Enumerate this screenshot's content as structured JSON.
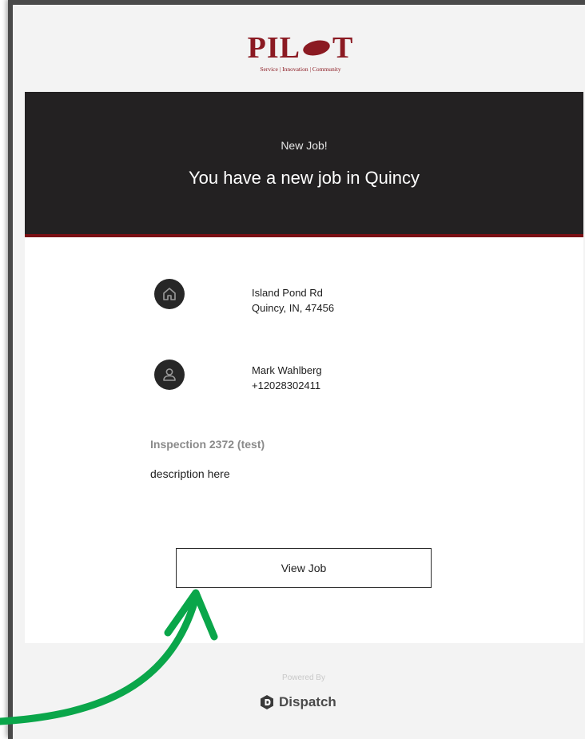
{
  "logo": {
    "text_left": "PIL",
    "text_right": "T",
    "tagline": "Service | Innovation | Community"
  },
  "hero": {
    "subtitle": "New Job!",
    "title": "You have a new job in Quincy"
  },
  "address": {
    "line1": "Island Pond Rd",
    "line2": "Quincy, IN, 47456",
    "icon": "home-icon"
  },
  "contact": {
    "name": "Mark Wahlberg",
    "phone": "+12028302411",
    "icon": "person-icon"
  },
  "job": {
    "title": "Inspection 2372 (test)",
    "description": "description here",
    "button_label": "View Job"
  },
  "footer": {
    "powered_by": "Powered By",
    "brand": "Dispatch"
  },
  "colors": {
    "brand_red": "#8b1a22",
    "hero_bg": "#232122",
    "annotation_arrow": "#0aa64a"
  }
}
